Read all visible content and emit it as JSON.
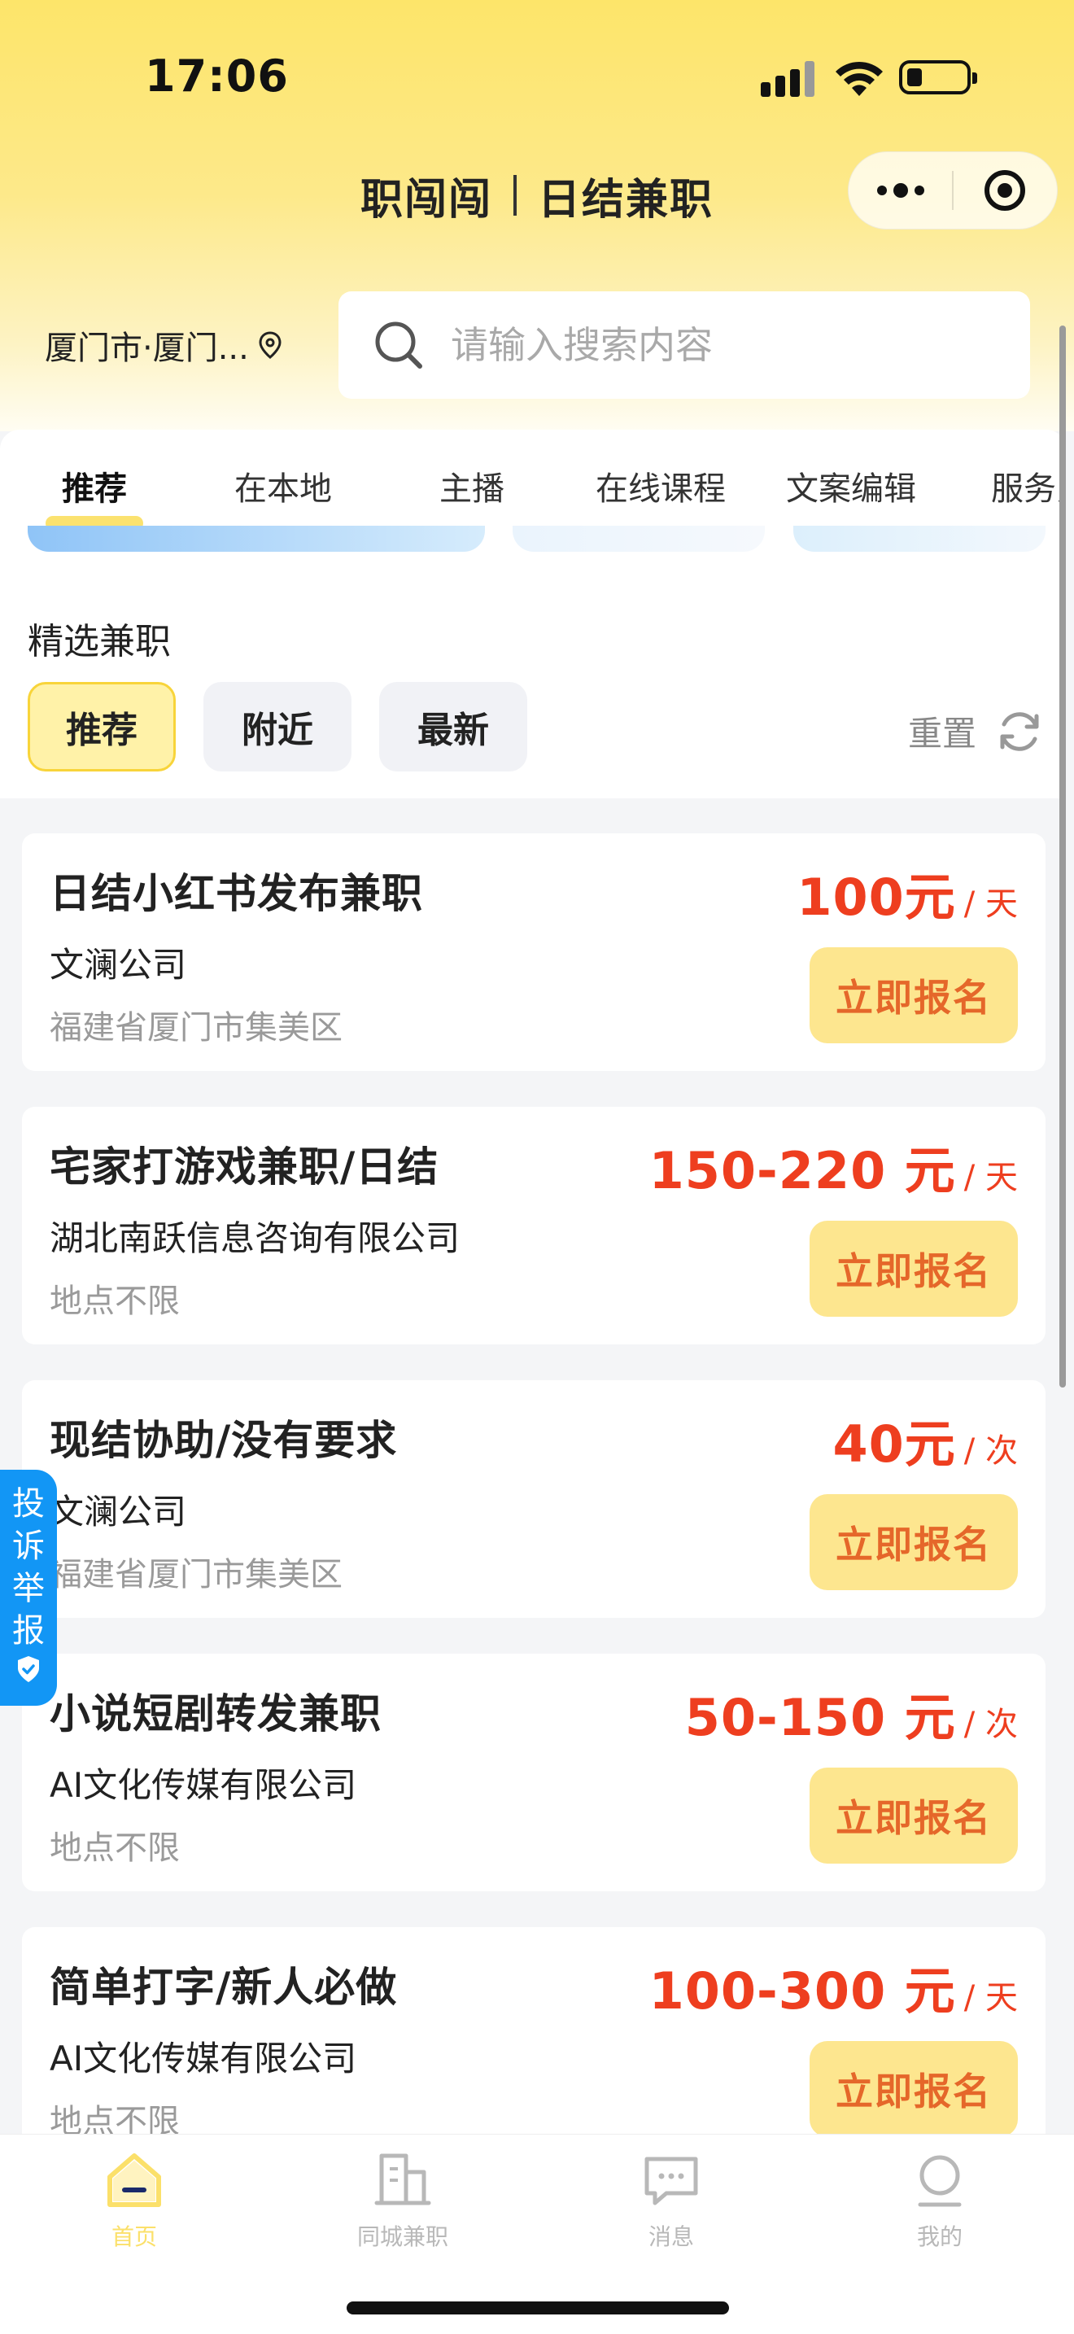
{
  "status_bar": {
    "time": "17:06"
  },
  "nav": {
    "brand": "职闯闯",
    "subtitle": "日结兼职"
  },
  "location": {
    "text": "厦门市·厦门..."
  },
  "search": {
    "placeholder": "请输入搜索内容"
  },
  "category_tabs": [
    {
      "label": "推荐",
      "active": true
    },
    {
      "label": "在本地",
      "active": false
    },
    {
      "label": "主播",
      "active": false
    },
    {
      "label": "在线课程",
      "active": false
    },
    {
      "label": "文案编辑",
      "active": false
    },
    {
      "label": "服务员",
      "active": false
    }
  ],
  "section": {
    "title": "精选兼职",
    "reset_label": "重置"
  },
  "filters": [
    {
      "label": "推荐",
      "active": true
    },
    {
      "label": "附近",
      "active": false
    },
    {
      "label": "最新",
      "active": false
    }
  ],
  "jobs": [
    {
      "title": "日结小红书发布兼职",
      "salary": "100元",
      "unit": "/ 天",
      "company": "文澜公司",
      "location": "福建省厦门市集美区",
      "apply_label": "立即报名"
    },
    {
      "title": "宅家打游戏兼职/日结",
      "salary": "150-220 元",
      "unit": "/ 天",
      "company": "湖北南跃信息咨询有限公司",
      "location": "地点不限",
      "apply_label": "立即报名"
    },
    {
      "title": "现结协助/没有要求",
      "salary": "40元",
      "unit": "/ 次",
      "company": "文澜公司",
      "location": "福建省厦门市集美区",
      "apply_label": "立即报名"
    },
    {
      "title": "小说短剧转发兼职",
      "salary": "50-150 元",
      "unit": "/ 次",
      "company": "AI文化传媒有限公司",
      "location": "地点不限",
      "apply_label": "立即报名"
    },
    {
      "title": "简单打字/新人必做",
      "salary": "100-300 元",
      "unit": "/ 天",
      "company": "AI文化传媒有限公司",
      "location": "地点不限",
      "apply_label": "立即报名"
    }
  ],
  "complaint": {
    "chars": [
      "投",
      "诉",
      "举",
      "报"
    ]
  },
  "bottom_nav": [
    {
      "label": "首页",
      "icon": "home-icon",
      "active": true
    },
    {
      "label": "同城兼职",
      "icon": "building-icon",
      "active": false
    },
    {
      "label": "消息",
      "icon": "message-icon",
      "active": false
    },
    {
      "label": "我的",
      "icon": "user-icon",
      "active": false
    }
  ],
  "colors": {
    "brand_yellow": "#fde56a",
    "price_red": "#ee3e1f",
    "button_bg": "#fde68f",
    "button_text": "#e5672a",
    "complaint_blue": "#1296f5"
  }
}
